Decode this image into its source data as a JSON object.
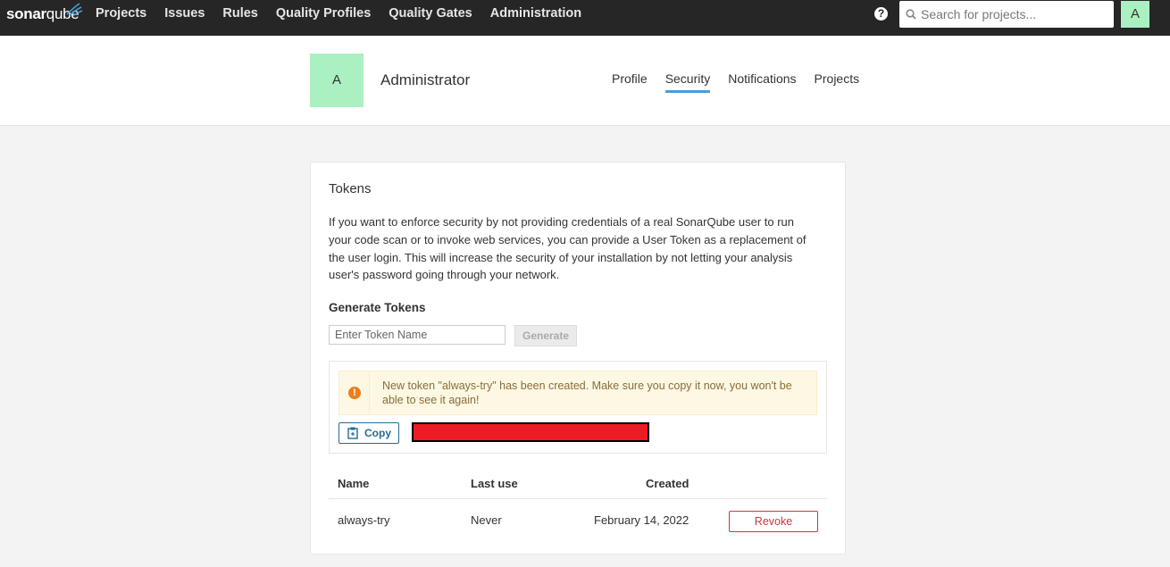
{
  "nav": {
    "logo_bold": "sonar",
    "logo_light": "qube",
    "items": [
      "Projects",
      "Issues",
      "Rules",
      "Quality Profiles",
      "Quality Gates",
      "Administration"
    ],
    "help_glyph": "?",
    "search_placeholder": "Search for projects...",
    "avatar_letter": "A"
  },
  "account": {
    "avatar_letter": "A",
    "name": "Administrator",
    "tabs": [
      "Profile",
      "Security",
      "Notifications",
      "Projects"
    ],
    "active_tab": "Security"
  },
  "tokens": {
    "title": "Tokens",
    "description": "If you want to enforce security by not providing credentials of a real SonarQube user to run your code scan or to invoke web services, you can provide a User Token as a replacement of the user login. This will increase the security of your installation by not letting your analysis user's password going through your network.",
    "generate_title": "Generate Tokens",
    "input_placeholder": "Enter Token Name",
    "generate_label": "Generate",
    "alert_text": "New token \"always-try\" has been created. Make sure you copy it now, you won't be able to see it again!",
    "copy_label": "Copy",
    "columns": {
      "name": "Name",
      "last_use": "Last use",
      "created": "Created"
    },
    "rows": [
      {
        "name": "always-try",
        "last_use": "Never",
        "created": "February 14, 2022",
        "action": "Revoke"
      }
    ]
  },
  "colors": {
    "nav_bg": "#262626",
    "avatar_bg": "#aaf0c0",
    "active_tab": "#4b9fd5",
    "alert_bg": "#fcf8e3",
    "alert_icon": "#ed7d20",
    "copy_blue": "#236a97",
    "revoke_red": "#d4333f",
    "redaction": "#ed1c24"
  }
}
